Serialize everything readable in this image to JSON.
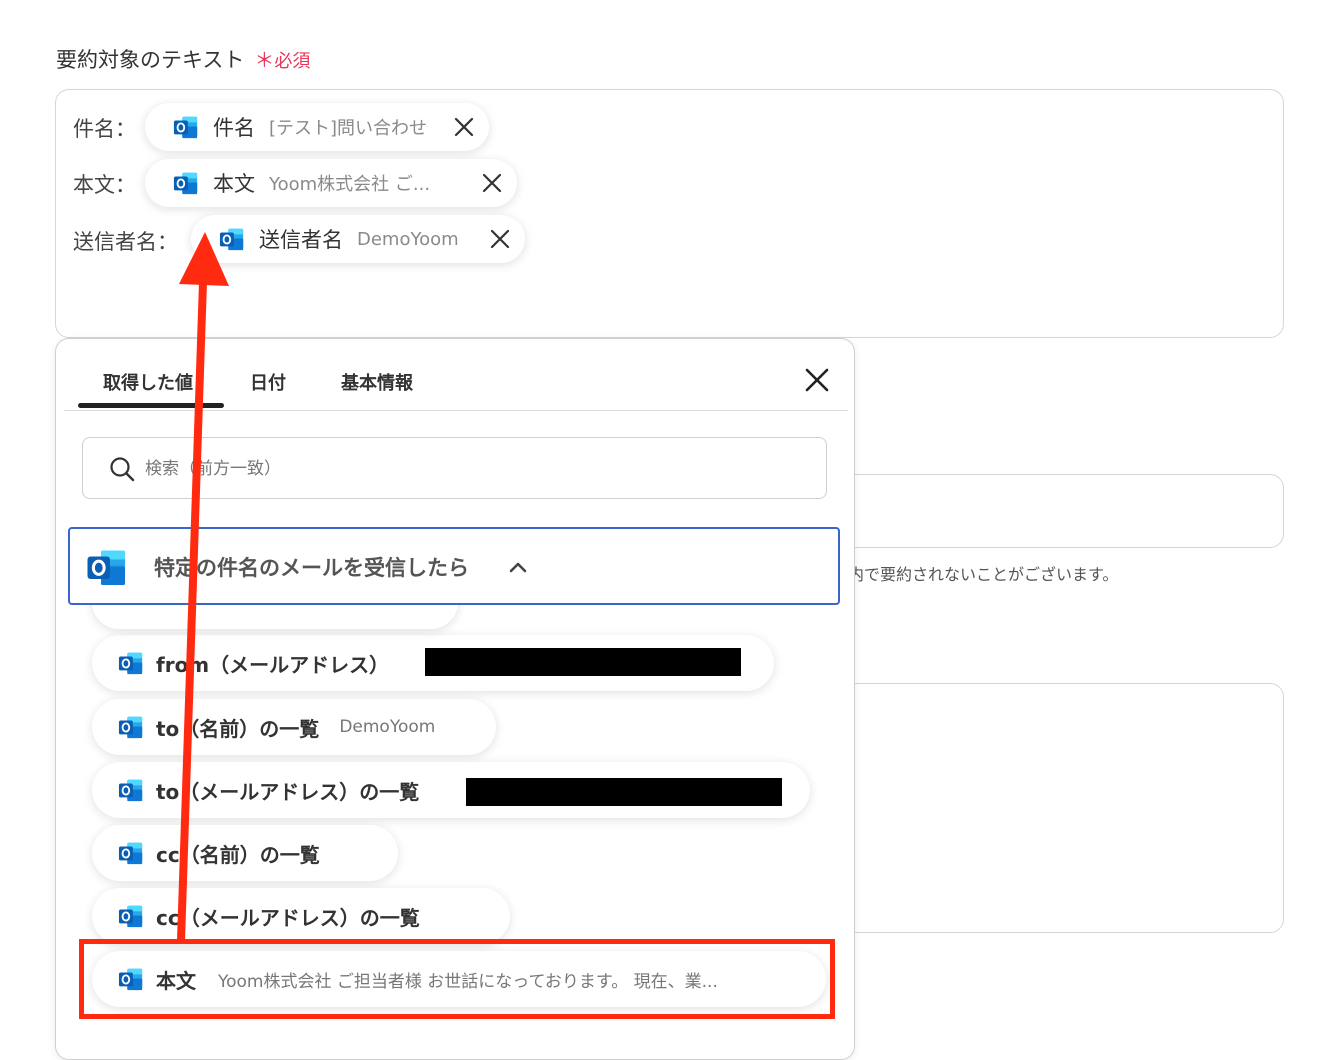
{
  "field": {
    "label": "要約対象のテキスト",
    "required_mark": "＊",
    "required_text": "必須"
  },
  "editor": {
    "lines": [
      {
        "label": "件名：",
        "chip_name": "件名",
        "chip_value": "[テスト]問い合わせ"
      },
      {
        "label": "本文：",
        "chip_name": "本文",
        "chip_value": "Yoom株式会社 ご..."
      },
      {
        "label": "送信者名：",
        "chip_name": "送信者名",
        "chip_value": "DemoYoom"
      }
    ]
  },
  "background": {
    "note": "内で要約されないことがございます。"
  },
  "popup": {
    "tabs": [
      {
        "label": "取得した値",
        "active": true
      },
      {
        "label": "日付",
        "active": false
      },
      {
        "label": "基本情報",
        "active": false
      }
    ],
    "search_placeholder": "検索（前方一致）",
    "section_title": "特定の件名のメールを受信したら",
    "items": [
      {
        "name": "from（メールアドレス）",
        "value": "",
        "redacted": true
      },
      {
        "name": "to（名前）の一覧",
        "value": "DemoYoom",
        "redacted": false
      },
      {
        "name": "to（メールアドレス）の一覧",
        "value": "",
        "redacted": true
      },
      {
        "name": "cc（名前）の一覧",
        "value": "",
        "redacted": false
      },
      {
        "name": "cc（メールアドレス）の一覧",
        "value": "",
        "redacted": false
      },
      {
        "name": "本文",
        "value": "Yoom株式会社 ご担当者様 お世話になっております。 現在、業...",
        "redacted": false
      }
    ]
  },
  "colors": {
    "required": "#e8365a",
    "annotation": "#ff2a10",
    "section_border": "#3b66c9",
    "outlook_blue": "#0f6cbd"
  },
  "icons": {
    "chip_icon": "outlook-icon",
    "remove": "close-icon",
    "search": "search-icon",
    "section_toggle": "chevron-up-icon"
  }
}
